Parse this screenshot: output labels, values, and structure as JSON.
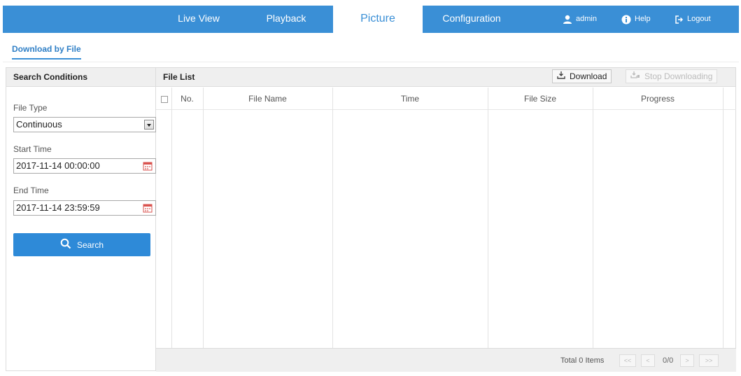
{
  "nav": {
    "tabs": [
      {
        "label": "Live View",
        "active": false
      },
      {
        "label": "Playback",
        "active": false
      },
      {
        "label": "Picture",
        "active": true
      },
      {
        "label": "Configuration",
        "active": false
      }
    ],
    "user": "admin",
    "help": "Help",
    "logout": "Logout",
    "accent_color": "#3a8fd6"
  },
  "subtab": {
    "label": "Download by File"
  },
  "search_panel": {
    "title": "Search Conditions",
    "file_type_label": "File Type",
    "file_type_value": "Continuous",
    "start_time_label": "Start Time",
    "start_time_value": "2017-11-14 00:00:00",
    "end_time_label": "End Time",
    "end_time_value": "2017-11-14 23:59:59",
    "search_button": "Search"
  },
  "file_list": {
    "title": "File List",
    "download_button": "Download",
    "stop_button": "Stop Downloading",
    "columns": [
      "No.",
      "File Name",
      "Time",
      "File Size",
      "Progress"
    ],
    "rows": [],
    "total": "Total 0 Items",
    "page": "0/0",
    "pager": {
      "first": "<<",
      "prev": "<",
      "next": ">",
      "last": ">>"
    }
  }
}
